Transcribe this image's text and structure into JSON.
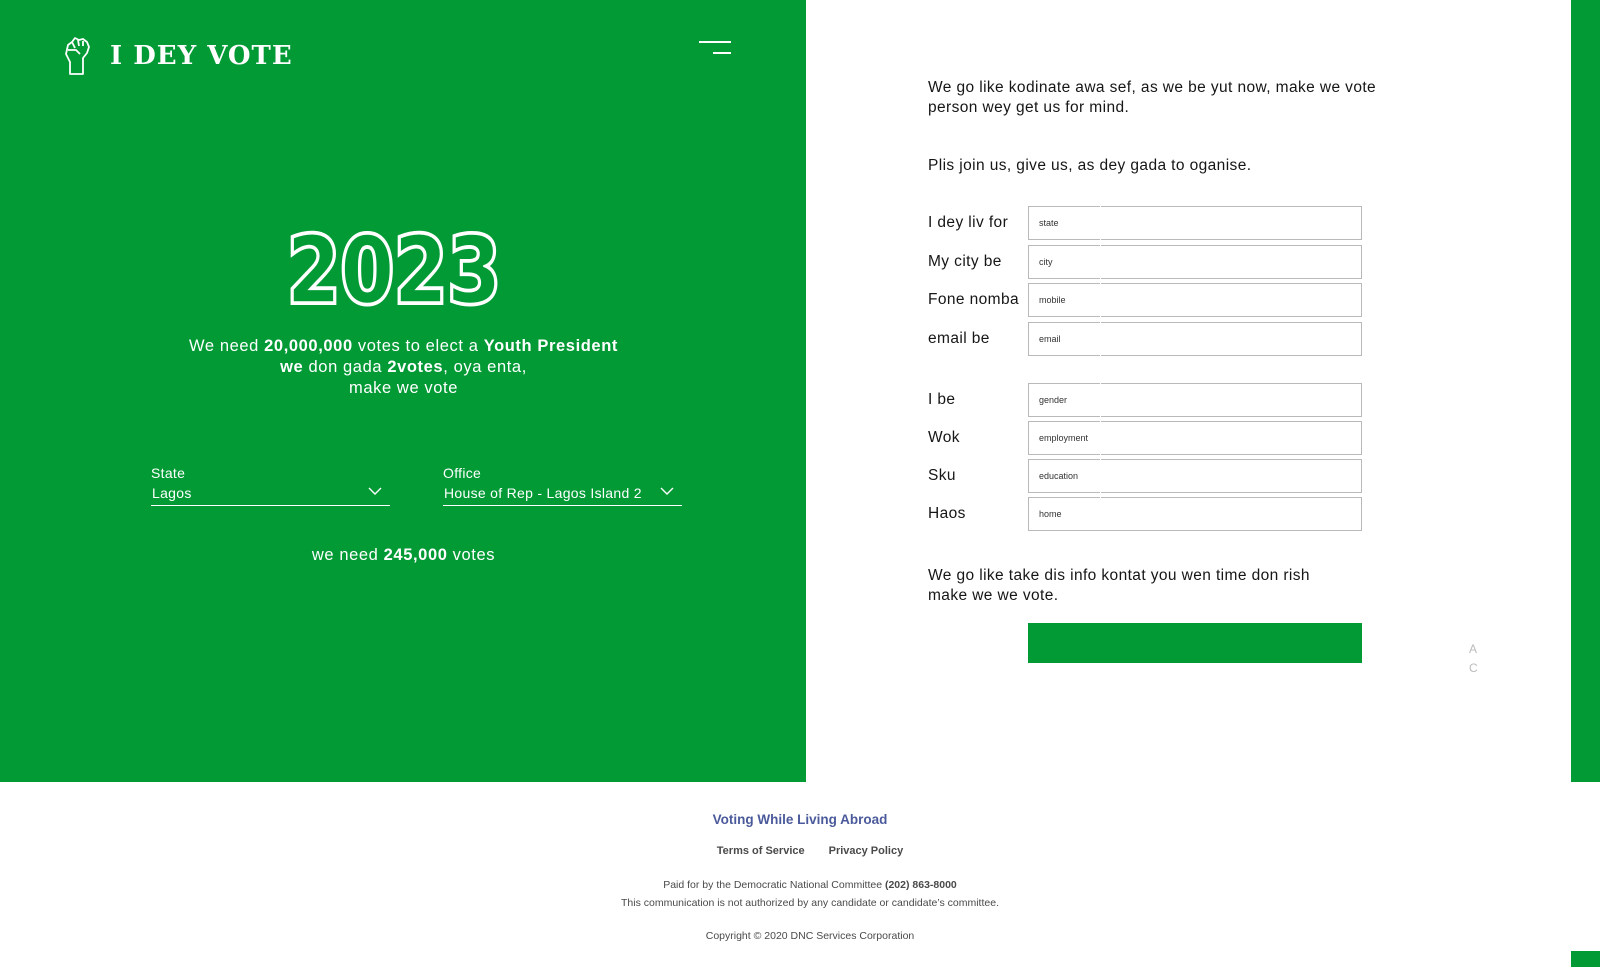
{
  "brand": {
    "name": "I DEY VOTE"
  },
  "colors": {
    "primary": "#029a35",
    "link": "#4b5a9b",
    "text": "#161616"
  },
  "hero": {
    "year": "2023",
    "line1_a": "We need ",
    "line1_b": "20,000,000",
    "line1_c": " votes to elect a ",
    "line1_d": "Youth President",
    "line2_a": "we",
    "line2_b": " don gada ",
    "line2_c": "2votes",
    "line2_d": ", oya enta,",
    "line3": "make we vote"
  },
  "selectors": {
    "state": {
      "label": "State",
      "value": "Lagos"
    },
    "office": {
      "label": "Office",
      "value": "House of Rep - Lagos Island 2"
    }
  },
  "need": {
    "pre": "we need ",
    "count": "245,000",
    "post": " votes"
  },
  "form": {
    "intro": "We go like kodinate awa sef, as we be yut now, make we vote person wey get us for mind.",
    "join": "Plis join us, give us, as dey gada to oganise.",
    "fields": [
      {
        "label": "I dey liv for",
        "placeholder": "state"
      },
      {
        "label": "My city be",
        "placeholder": "city"
      },
      {
        "label": "Fone nomba",
        "placeholder": "mobile"
      },
      {
        "label": "email be",
        "placeholder": "email"
      },
      {
        "label": "I be",
        "placeholder": "gender"
      },
      {
        "label": "Wok",
        "placeholder": "employment"
      },
      {
        "label": "Sku",
        "placeholder": "education"
      },
      {
        "label": "Haos",
        "placeholder": "home"
      }
    ],
    "outro": "We go like take dis info kontat you wen time don rish make we we vote.",
    "cut_text_1": "A",
    "cut_text_2": "C"
  },
  "footer": {
    "abroad": "Voting While Living Abroad",
    "terms": "Terms of Service",
    "privacy": "Privacy Policy",
    "paid_a": "Paid for by the Democratic National Committee ",
    "paid_phone": "(202) 863-8000",
    "disclaimer": "This communication is not authorized by any candidate or candidate’s committee.",
    "copyright": "Copyright © 2020 DNC Services Corporation"
  }
}
